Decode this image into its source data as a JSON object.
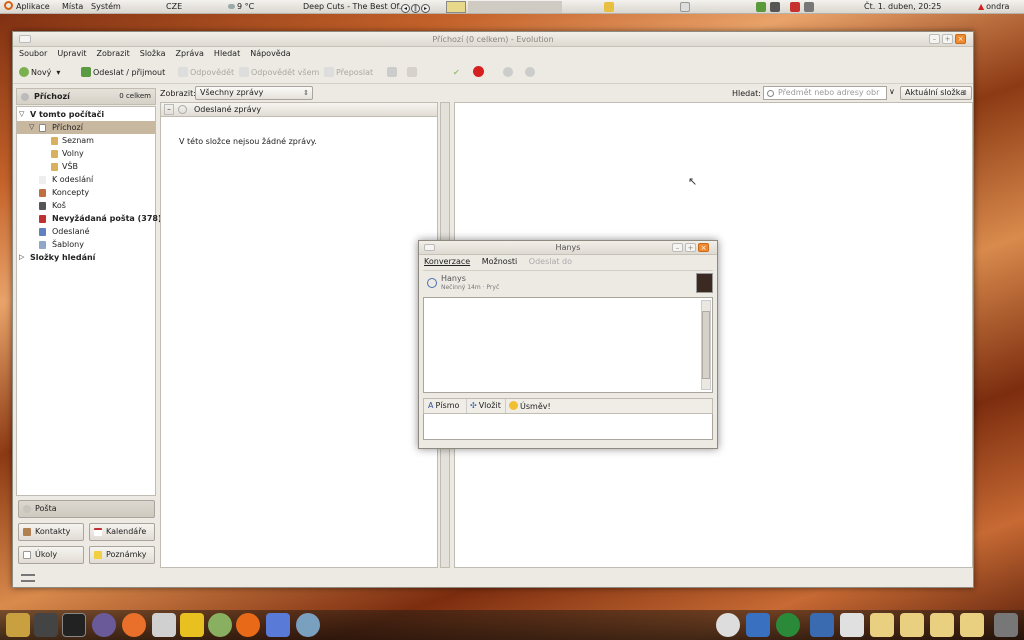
{
  "top_panel": {
    "menus": [
      "Aplikace",
      "Místa",
      "Systém"
    ],
    "keyboard": "CZE",
    "weather": "9 °C",
    "now_playing": "Deep Cuts - The Best Of...",
    "clock": "Čt. 1. duben, 20:25",
    "user": "ondra"
  },
  "evolution": {
    "window_title": "Příchozí (0 celkem) - Evolution",
    "menu": [
      "Soubor",
      "Upravit",
      "Zobrazit",
      "Složka",
      "Zpráva",
      "Hledat",
      "Nápověda"
    ],
    "toolbar": {
      "new": "Nový",
      "send_receive": "Odeslat / přijmout",
      "reply": "Odpovědět",
      "reply_all": "Odpovědět všem",
      "forward": "Přeposlat"
    },
    "view": {
      "label": "Zobrazit:",
      "value": "Všechny zprávy"
    },
    "search": {
      "label": "Hledat:",
      "placeholder": "Předmět nebo adresy obr",
      "scope": "Aktuální složka"
    },
    "folder_header": {
      "title": "Příchozí",
      "count": "0 celkem"
    },
    "folders": {
      "local": "V tomto počítači",
      "inbox": "Příchozí",
      "seznam": "Seznam",
      "volny": "Volny",
      "vsb": "VŠB",
      "outbox": "K odeslání",
      "drafts": "Koncepty",
      "trash": "Koš",
      "junk": "Nevyžádaná pošta (378)",
      "sent": "Odeslané",
      "templates": "Šablony",
      "search_folders": "Složky hledání"
    },
    "switcher": {
      "mail": "Pošta",
      "contacts": "Kontakty",
      "calendars": "Kalendáře",
      "tasks": "Úkoly",
      "memos": "Poznámky"
    },
    "message_list": {
      "column": "Odeslané zprávy",
      "empty": "V této složce nejsou žádné zprávy."
    }
  },
  "chat": {
    "title": "Hanys",
    "menu": [
      "Konverzace",
      "Možnosti",
      "Odeslat do"
    ],
    "contact_name": "Hanys",
    "contact_status": "Nečinný 14m · Pryč",
    "toolbar": {
      "font": "Písmo",
      "insert": "Vložit",
      "smiley": "Úsměv!"
    }
  }
}
